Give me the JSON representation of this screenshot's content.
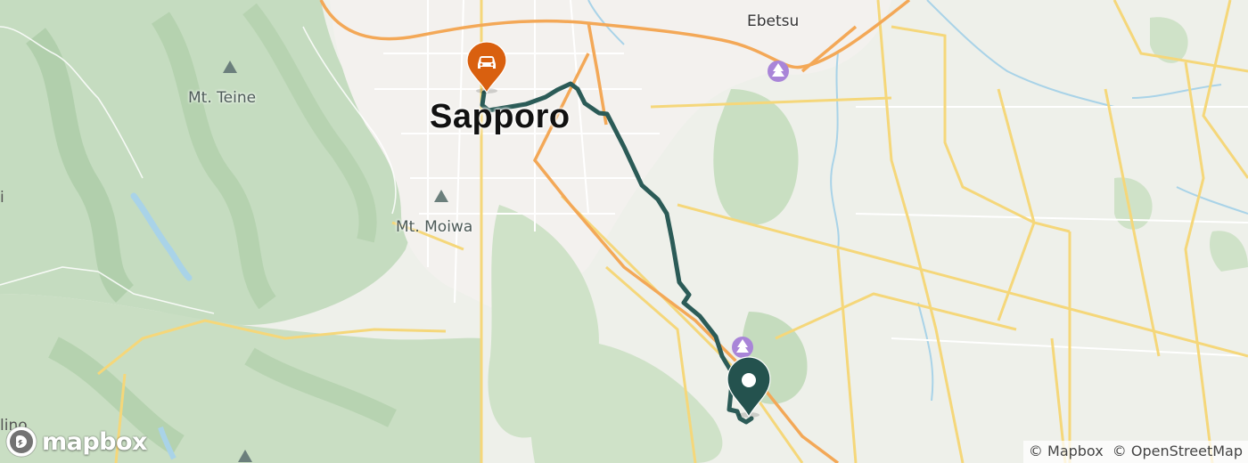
{
  "labels": {
    "city_main": "Sapporo",
    "city_secondary": "Ebetsu",
    "peaks": [
      "Mt. Teine",
      "Mt. Moiwa"
    ],
    "edge_fragments": [
      "i",
      "lino"
    ]
  },
  "markers": {
    "origin": {
      "icon": "car-icon",
      "color": "#d9600f"
    },
    "destination": {
      "icon": "circle-icon",
      "color": "#24524e"
    }
  },
  "route": {
    "color": "#2b5b57"
  },
  "branding": {
    "logo_text": "mapbox"
  },
  "attribution": [
    "© Mapbox",
    "© OpenStreetMap"
  ]
}
